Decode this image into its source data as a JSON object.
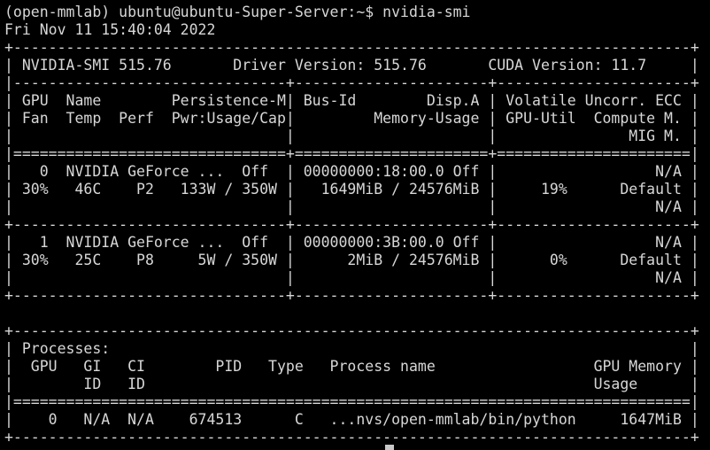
{
  "terminal": {
    "lines": [
      "(open-mmlab) ubuntu@ubuntu-Super-Server:~$ nvidia-smi",
      "Fri Nov 11 15:40:04 2022",
      "+-----------------------------------------------------------------------------+",
      "| NVIDIA-SMI 515.76       Driver Version: 515.76       CUDA Version: 11.7     |",
      "|-------------------------------+----------------------+----------------------+",
      "| GPU  Name        Persistence-M| Bus-Id        Disp.A | Volatile Uncorr. ECC |",
      "| Fan  Temp  Perf  Pwr:Usage/Cap|         Memory-Usage | GPU-Util  Compute M. |",
      "|                               |                      |               MIG M. |",
      "|===============================+======================+======================|",
      "|   0  NVIDIA GeForce ...  Off  | 00000000:18:00.0 Off |                  N/A |",
      "| 30%   46C    P2   133W / 350W |   1649MiB / 24576MiB |     19%      Default |",
      "|                               |                      |                  N/A |",
      "+-------------------------------+----------------------+----------------------+",
      "|   1  NVIDIA GeForce ...  Off  | 00000000:3B:00.0 Off |                  N/A |",
      "| 30%   25C    P8     5W / 350W |      2MiB / 24576MiB |      0%      Default |",
      "|                               |                      |                  N/A |",
      "+-------------------------------+----------------------+----------------------+",
      "",
      "+-----------------------------------------------------------------------------+",
      "| Processes:                                                                  |",
      "|  GPU   GI   CI        PID   Type   Process name                  GPU Memory |",
      "|        ID   ID                                                   Usage      |",
      "|=============================================================================|",
      "|    0   N/A  N/A    674513      C   ...nvs/open-mmlab/bin/python     1647MiB |",
      "+-----------------------------------------------------------------------------+"
    ]
  }
}
